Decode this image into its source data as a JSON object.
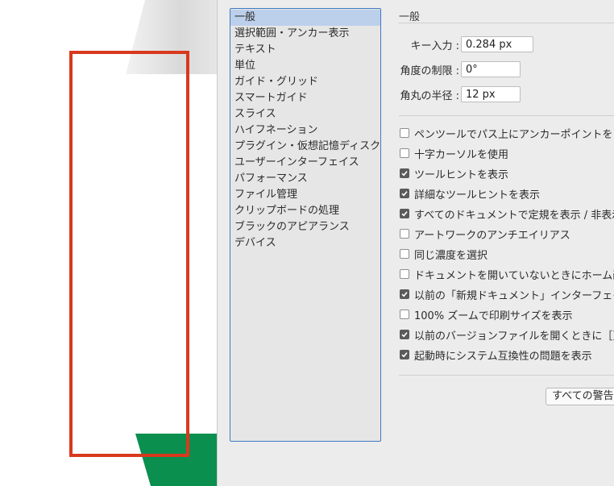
{
  "categories": [
    {
      "label": "一般",
      "selected": true
    },
    {
      "label": "選択範囲・アンカー表示",
      "selected": false
    },
    {
      "label": "テキスト",
      "selected": false
    },
    {
      "label": "単位",
      "selected": false
    },
    {
      "label": "ガイド・グリッド",
      "selected": false
    },
    {
      "label": "スマートガイド",
      "selected": false
    },
    {
      "label": "スライス",
      "selected": false
    },
    {
      "label": "ハイフネーション",
      "selected": false
    },
    {
      "label": "プラグイン・仮想記憶ディスク",
      "selected": false
    },
    {
      "label": "ユーザーインターフェイス",
      "selected": false
    },
    {
      "label": "パフォーマンス",
      "selected": false
    },
    {
      "label": "ファイル管理",
      "selected": false
    },
    {
      "label": "クリップボードの処理",
      "selected": false
    },
    {
      "label": "ブラックのアピアランス",
      "selected": false
    },
    {
      "label": "デバイス",
      "selected": false
    }
  ],
  "general": {
    "section_title": "一般",
    "fields": [
      {
        "label": "キー入力 :",
        "value": "0.284 px"
      },
      {
        "label": "角度の制限 :",
        "value": "0°"
      },
      {
        "label": "角丸の半径 :",
        "value": "12 px"
      }
    ],
    "options": [
      {
        "label": "ペンツールでパス上にアンカーポイントを自",
        "checked": false
      },
      {
        "label": "十字カーソルを使用",
        "checked": false
      },
      {
        "label": "ツールヒントを表示",
        "checked": true
      },
      {
        "label": "詳細なツールヒントを表示",
        "checked": true
      },
      {
        "label": "すべてのドキュメントで定規を表示 / 非表示",
        "checked": true
      },
      {
        "label": "アートワークのアンチエイリアス",
        "checked": false
      },
      {
        "label": "同じ濃度を選択",
        "checked": false
      },
      {
        "label": "ドキュメントを開いていないときにホーム画",
        "checked": false
      },
      {
        "label": "以前の「新規ドキュメント」インターフェイ",
        "checked": true
      },
      {
        "label": "100% ズームで印刷サイズを表示",
        "checked": false
      },
      {
        "label": "以前のバージョンファイルを開くときに［更",
        "checked": true
      },
      {
        "label": "起動時にシステム互換性の問題を表示",
        "checked": true
      }
    ],
    "reset_button": "すべての警告"
  },
  "colors": {
    "highlight_frame": "#d8391e",
    "green_shape": "#0b8f4f",
    "selection": "#bcd0ec",
    "list_border": "#3f79c4"
  }
}
